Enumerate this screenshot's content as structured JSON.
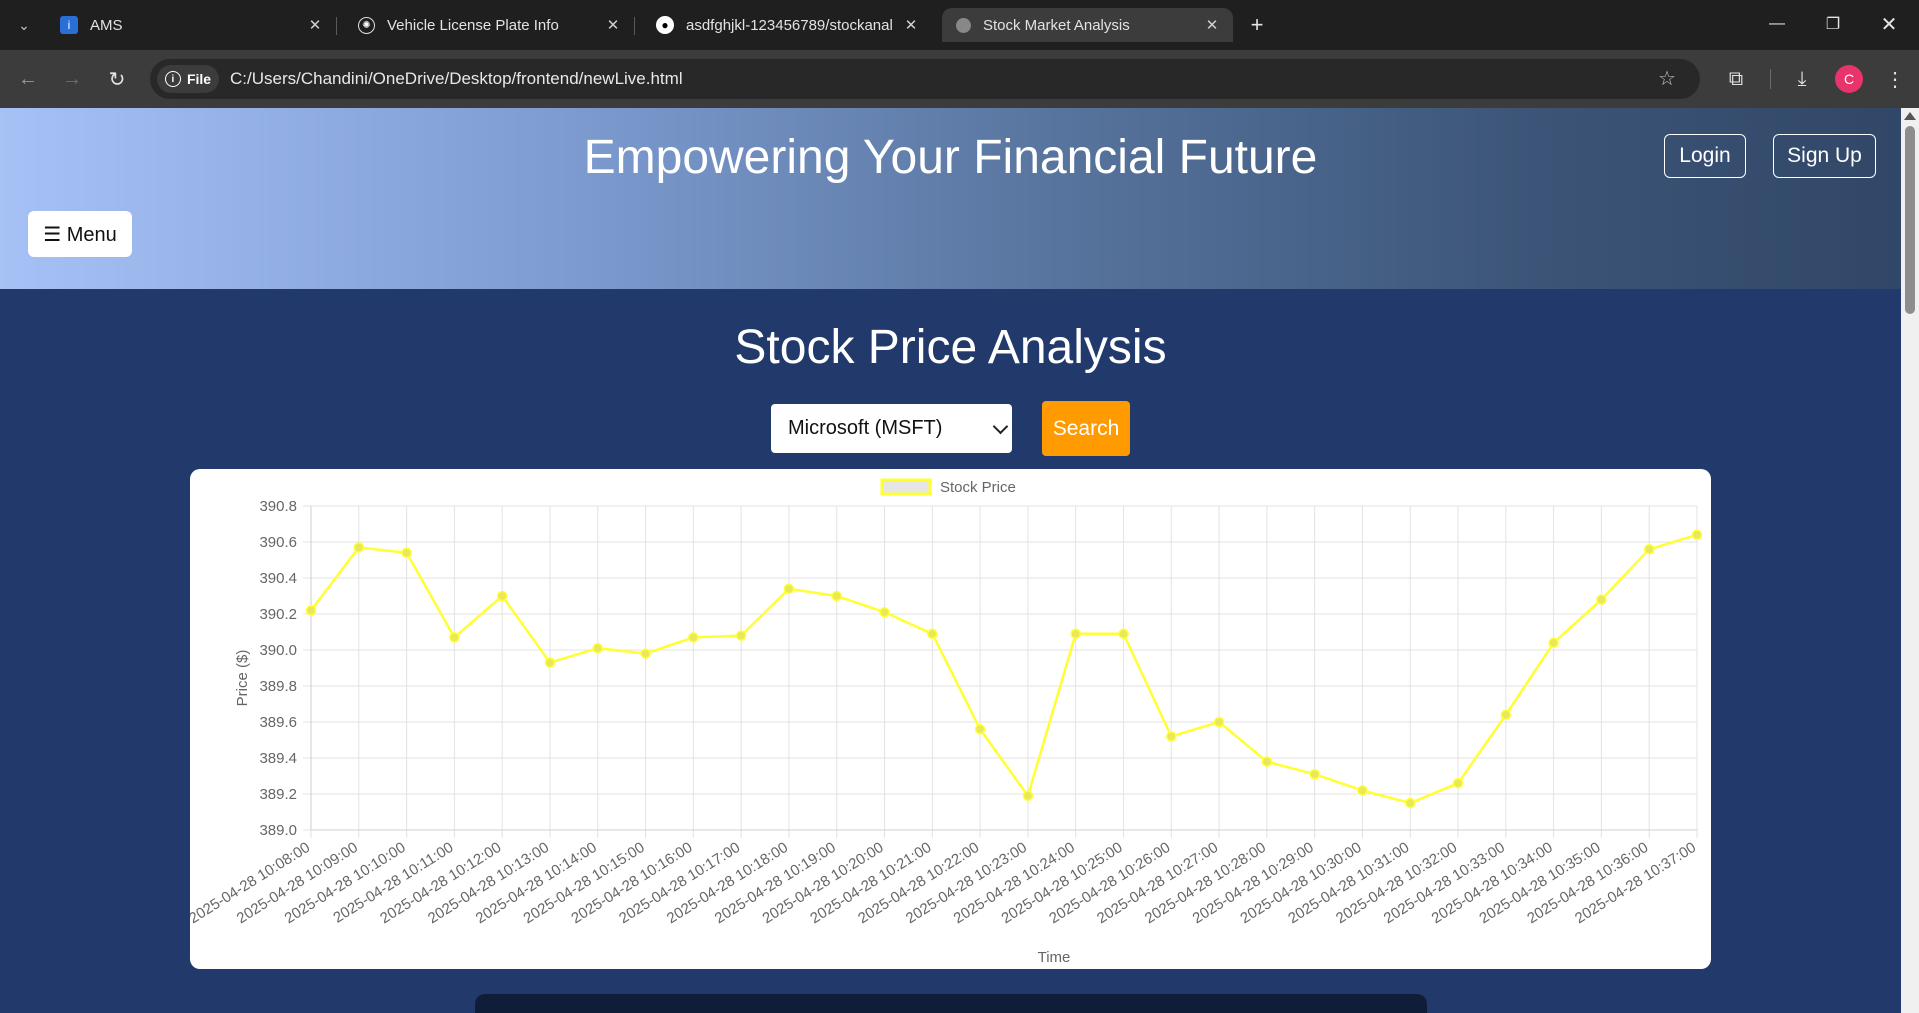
{
  "browser": {
    "tabs": [
      {
        "title": "AMS",
        "icon": "ams-favicon",
        "active": false
      },
      {
        "title": "Vehicle License Plate Info",
        "icon": "openai-favicon",
        "active": false
      },
      {
        "title": "asdfghjkl-123456789/stockanal",
        "icon": "github-favicon",
        "active": false
      },
      {
        "title": "Stock Market Analysis",
        "icon": "globe-favicon",
        "active": true
      }
    ],
    "chip_label": "File",
    "url": "C:/Users/Chandini/OneDrive/Desktop/frontend/newLive.html",
    "profile_initial": "C"
  },
  "header": {
    "title": "Empowering Your Financial Future",
    "login_label": "Login",
    "signup_label": "Sign Up",
    "menu_label": "☰ Menu"
  },
  "main": {
    "title": "Stock Price Analysis",
    "selected_stock": "Microsoft (MSFT)",
    "search_label": "Search"
  },
  "colors": {
    "accent_orange": "#ff9a00",
    "page_bg": "#213a6b",
    "line": "#ffff33"
  },
  "chart_data": {
    "type": "line",
    "title": "",
    "legend": [
      "Stock Price"
    ],
    "legend_placement": "top-center",
    "xlabel": "Time",
    "ylabel": "Price ($)",
    "ylim": [
      389.0,
      390.8
    ],
    "yticks": [
      "390.8",
      "390.6",
      "390.4",
      "390.2",
      "390.0",
      "389.8",
      "389.6",
      "389.4",
      "389.2",
      "389.0"
    ],
    "grid": true,
    "x": [
      "2025-04-28 10:08:00",
      "2025-04-28 10:09:00",
      "2025-04-28 10:10:00",
      "2025-04-28 10:11:00",
      "2025-04-28 10:12:00",
      "2025-04-28 10:13:00",
      "2025-04-28 10:14:00",
      "2025-04-28 10:15:00",
      "2025-04-28 10:16:00",
      "2025-04-28 10:17:00",
      "2025-04-28 10:18:00",
      "2025-04-28 10:19:00",
      "2025-04-28 10:20:00",
      "2025-04-28 10:21:00",
      "2025-04-28 10:22:00",
      "2025-04-28 10:23:00",
      "2025-04-28 10:24:00",
      "2025-04-28 10:25:00",
      "2025-04-28 10:26:00",
      "2025-04-28 10:27:00",
      "2025-04-28 10:28:00",
      "2025-04-28 10:29:00",
      "2025-04-28 10:30:00",
      "2025-04-28 10:31:00",
      "2025-04-28 10:32:00",
      "2025-04-28 10:33:00",
      "2025-04-28 10:34:00",
      "2025-04-28 10:35:00",
      "2025-04-28 10:36:00",
      "2025-04-28 10:37:00"
    ],
    "series": [
      {
        "name": "Stock Price",
        "values": [
          390.22,
          390.57,
          390.54,
          390.07,
          390.3,
          389.93,
          390.01,
          389.98,
          390.07,
          390.08,
          390.34,
          390.3,
          390.21,
          390.09,
          389.56,
          389.19,
          390.09,
          390.09,
          389.52,
          389.6,
          389.38,
          389.31,
          389.22,
          389.15,
          389.26,
          389.64,
          390.04,
          390.28,
          390.56,
          390.64
        ]
      }
    ]
  }
}
